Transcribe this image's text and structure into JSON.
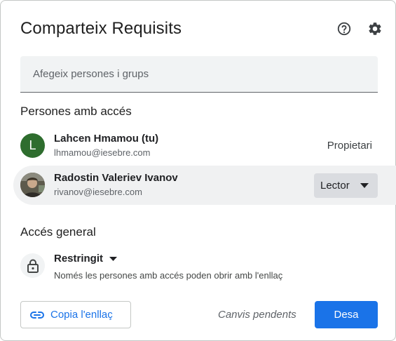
{
  "dialog": {
    "title": "Comparteix Requisits"
  },
  "header_icons": [
    "help-circle-icon",
    "gear-icon"
  ],
  "add_people": {
    "placeholder": "Afegeix persones i grups",
    "value": ""
  },
  "people_section": {
    "heading": "Persones amb accés",
    "people": [
      {
        "name": "Lahcen Hmamou (tu)",
        "email": "lhmamou@iesebre.com",
        "avatar_letter": "L",
        "avatar_color": "#2e6d2e",
        "role": "Propietari"
      },
      {
        "name": "Radostin Valeriev Ivanov",
        "email": "rivanov@iesebre.com",
        "role": "Lector"
      }
    ]
  },
  "general_access": {
    "heading": "Accés general",
    "selected": "Restringit",
    "description": "Només les persones amb accés poden obrir amb l'enllaç"
  },
  "footer": {
    "copy_link_label": "Copia l'enllaç",
    "pending_label": "Canvis pendents",
    "save_label": "Desa"
  },
  "colors": {
    "accent": "#1a73e8",
    "selected_row": "#f0f1f2",
    "role_chip": "#dadce0"
  }
}
